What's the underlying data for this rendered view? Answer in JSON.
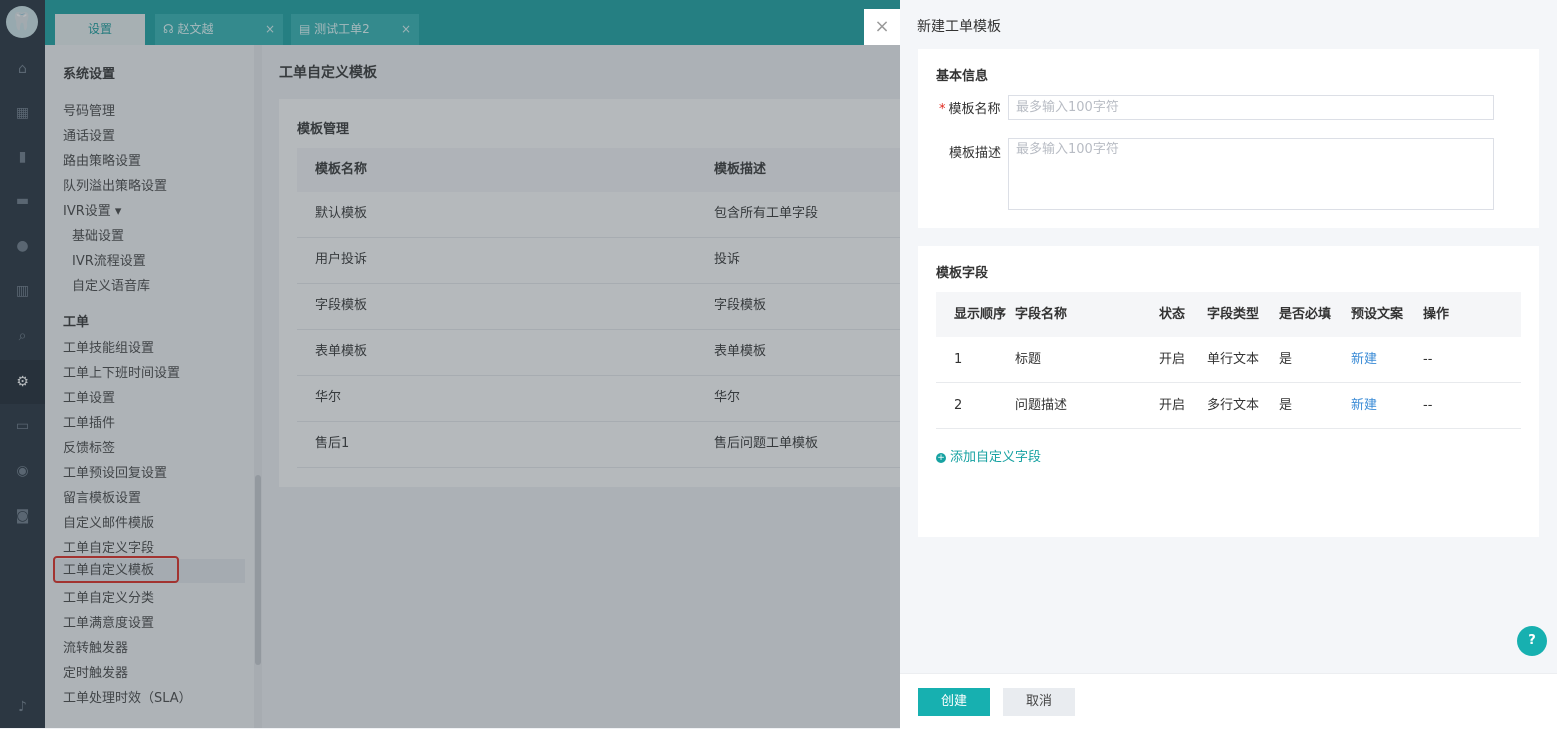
{
  "rail": {
    "logo_glyph": "🦷",
    "icons": [
      {
        "name": "home-icon",
        "glyph": "⌂"
      },
      {
        "name": "grid-icon",
        "glyph": "▦"
      },
      {
        "name": "document-icon",
        "glyph": "▮"
      },
      {
        "name": "chat-icon",
        "glyph": "▬"
      },
      {
        "name": "contacts-icon",
        "glyph": "●"
      },
      {
        "name": "chart-icon",
        "glyph": "▥"
      },
      {
        "name": "search-icon",
        "glyph": "⌕"
      },
      {
        "name": "gear-icon",
        "glyph": "⚙"
      },
      {
        "name": "monitor-icon",
        "glyph": "▭"
      },
      {
        "name": "download-icon",
        "glyph": "◉"
      },
      {
        "name": "user-icon",
        "glyph": "◙"
      },
      {
        "name": "bell-icon",
        "glyph": "♪"
      }
    ]
  },
  "tabs": [
    {
      "label": "设置",
      "icon": ""
    },
    {
      "label": "赵文越",
      "icon": "☊",
      "close": "×"
    },
    {
      "label": "测试工单2",
      "icon": "▤",
      "close": "×"
    }
  ],
  "sidebar": {
    "section1_title": "系统设置",
    "items1": [
      "号码管理",
      "通话设置",
      "路由策略设置",
      "队列溢出策略设置",
      "IVR设置 ▾"
    ],
    "items1_sub": [
      "基础设置",
      "IVR流程设置",
      "自定义语音库"
    ],
    "section2_title": "工单",
    "items2": [
      "工单技能组设置",
      "工单上下班时间设置",
      "工单设置",
      "工单插件",
      "反馈标签",
      "工单预设回复设置",
      "留言模板设置",
      "自定义邮件模版",
      "工单自定义字段",
      "工单自定义模板",
      "工单自定义分类",
      "工单满意度设置",
      "流转触发器",
      "定时触发器",
      "工单处理时效（SLA）"
    ],
    "selected_index": 9
  },
  "main": {
    "title": "工单自定义模板",
    "panel_title": "模板管理",
    "columns": [
      "模板名称",
      "模板描述"
    ],
    "rows": [
      [
        "默认模板",
        "包含所有工单字段"
      ],
      [
        "用户投诉",
        "投诉"
      ],
      [
        "字段模板",
        "字段模板"
      ],
      [
        "表单模板",
        "表单模板"
      ],
      [
        "华尔",
        "华尔"
      ],
      [
        "售后1",
        "售后问题工单模板"
      ]
    ]
  },
  "drawer": {
    "close_glyph": "×",
    "title": "新建工单模板",
    "basic_title": "基本信息",
    "name_label": "模板名称",
    "required_mark": "*",
    "name_placeholder": "最多输入100字符",
    "desc_label": "模板描述",
    "desc_placeholder": "最多输入100字符",
    "fields_title": "模板字段",
    "field_columns": [
      "显示顺序",
      "字段名称",
      "状态",
      "字段类型",
      "是否必填",
      "预设文案",
      "操作"
    ],
    "field_rows": [
      [
        "1",
        "标题",
        "开启",
        "单行文本",
        "是",
        "新建",
        "--"
      ],
      [
        "2",
        "问题描述",
        "开启",
        "多行文本",
        "是",
        "新建",
        "--"
      ]
    ],
    "add_field": "添加自定义字段",
    "add_glyph": "+",
    "create_button": "创建",
    "cancel_button": "取消"
  },
  "help_glyph": "?",
  "colors": {
    "accent": "#17a2a2",
    "rail": "#222e3a",
    "link": "#3a8bd6",
    "required": "#e0281e"
  }
}
